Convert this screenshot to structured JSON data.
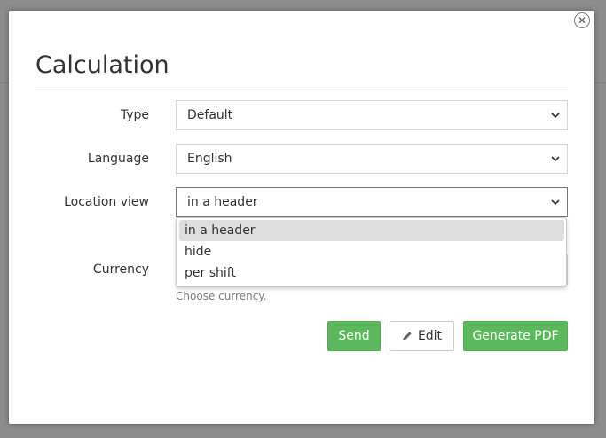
{
  "modal": {
    "title": "Calculation",
    "close_icon": "close-icon"
  },
  "form": {
    "type": {
      "label": "Type",
      "value": "Default"
    },
    "language": {
      "label": "Language",
      "value": "English"
    },
    "location_view": {
      "label": "Location view",
      "value": "in a header",
      "options": [
        "in a header",
        "hide",
        "per shift"
      ],
      "highlighted_option": "in a header"
    },
    "currency": {
      "label": "Currency",
      "help": "Choose currency."
    }
  },
  "buttons": {
    "send": "Send",
    "edit": "Edit",
    "generate_pdf": "Generate PDF"
  },
  "colors": {
    "primary_button": "#5cb85c",
    "backdrop": "#8c8c8c",
    "highlight": "#dedede"
  },
  "icons": {
    "edit": "pencil-icon",
    "select": "chevron-down-icon"
  }
}
